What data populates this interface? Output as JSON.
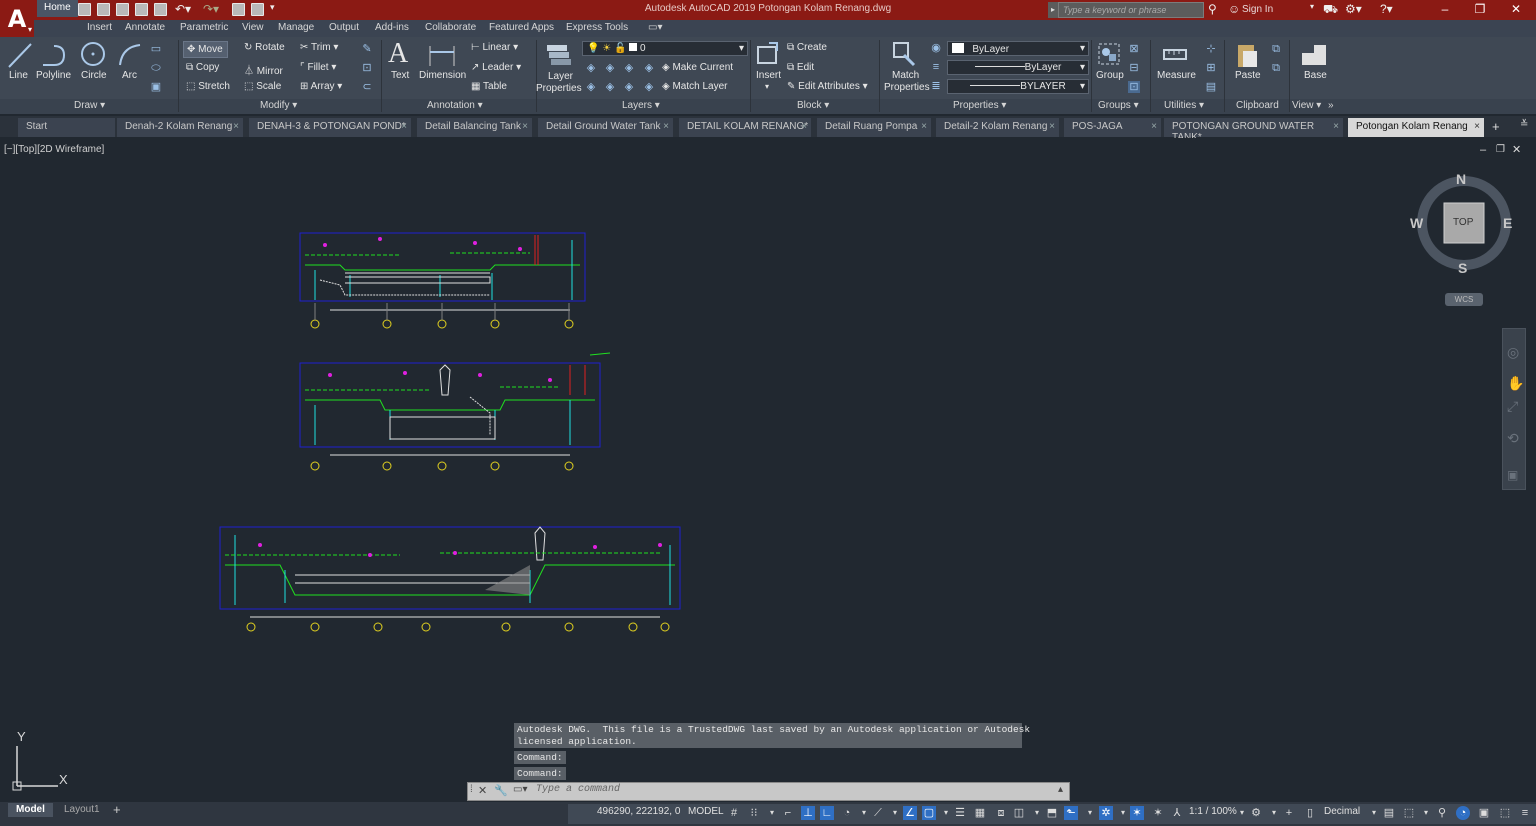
{
  "app": {
    "logo": "A",
    "title": "Autodesk AutoCAD 2019    Potongan Kolam Renang.dwg"
  },
  "search": {
    "placeholder": "Type a keyword or phrase"
  },
  "account": {
    "signin": "Sign In"
  },
  "ribbon_tabs": [
    "Home",
    "Insert",
    "Annotate",
    "Parametric",
    "View",
    "Manage",
    "Output",
    "Add-ins",
    "Collaborate",
    "Featured Apps",
    "Express Tools"
  ],
  "draw": {
    "line": "Line",
    "polyline": "Polyline",
    "circle": "Circle",
    "arc": "Arc",
    "panel": "Draw ▾"
  },
  "modify": {
    "move": "Move",
    "rotate": "Rotate",
    "trim": "Trim",
    "copy": "Copy",
    "mirror": "Mirror",
    "fillet": "Fillet",
    "stretch": "Stretch",
    "scale": "Scale",
    "array": "Array",
    "panel": "Modify ▾"
  },
  "annotation": {
    "text": "Text",
    "dimension": "Dimension",
    "linear": "Linear",
    "leader": "Leader",
    "table": "Table",
    "panel": "Annotation ▾"
  },
  "layers": {
    "layer_properties_1": "Layer",
    "layer_properties_2": "Properties",
    "current_layer": "0",
    "make_current": "Make Current",
    "match_layer": "Match Layer",
    "panel": "Layers ▾"
  },
  "block": {
    "insert": "Insert",
    "create": "Create",
    "edit": "Edit",
    "edit_attributes": "Edit Attributes",
    "panel": "Block ▾"
  },
  "properties": {
    "match_1": "Match",
    "match_2": "Properties",
    "color": "ByLayer",
    "linetype": "ByLayer",
    "lineweight": "BYLAYER",
    "panel": "Properties ▾"
  },
  "groups": {
    "group": "Group",
    "panel": "Groups ▾"
  },
  "utilities": {
    "measure": "Measure",
    "panel": "Utilities ▾"
  },
  "clipboard": {
    "paste": "Paste",
    "panel": "Clipboard"
  },
  "view": {
    "base": "Base",
    "panel": "View ▾"
  },
  "file_tabs": [
    "Start",
    "Denah-2 Kolam Renang",
    "DENAH-3 & POTONGAN POND*",
    "Detail Balancing Tank",
    "Detail Ground Water Tank",
    "DETAIL KOLAM RENANG*",
    "Detail Ruang Pompa",
    "Detail-2 Kolam Renang",
    "POS-JAGA",
    "POTONGAN GROUND WATER TANK*",
    "Potongan Kolam Renang"
  ],
  "viewport": {
    "label": "[−][Top][2D Wireframe]"
  },
  "viewcube": {
    "n": "N",
    "s": "S",
    "e": "E",
    "w": "W",
    "top": "TOP",
    "wcs": "WCS"
  },
  "ucs": {
    "x": "X",
    "y": "Y"
  },
  "command": {
    "history_1": "Autodesk DWG.  This file is a TrustedDWG last saved by an Autodesk application or Autodesk",
    "history_2": "licensed application.",
    "history_3": "Command:",
    "history_4": "Command:",
    "placeholder": "Type  a  command"
  },
  "layout_tabs": [
    "Model",
    "Layout1"
  ],
  "status": {
    "coords": "496290, 222192, 0",
    "space": "MODEL",
    "scale": "1:1 / 100%",
    "units": "Decimal"
  },
  "colors": {
    "titlebar": "#8b1a14",
    "ribbon": "#3f4854",
    "canvas": "#212830",
    "accent": "#2f6fc4"
  }
}
